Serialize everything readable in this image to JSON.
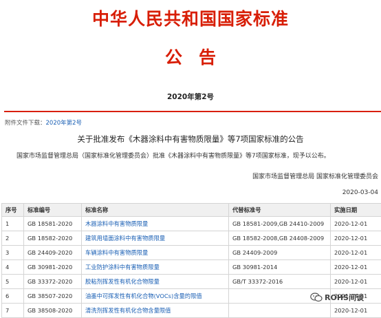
{
  "header": {
    "title": "中华人民共和国国家标准",
    "notice": "公告",
    "issue": "2020年第2号"
  },
  "attachment": {
    "label": "附件文件下载：",
    "link": "2020年第2号"
  },
  "announcement": {
    "title": "关于批准发布《木器涂料中有害物质限量》等7项国家标准的公告",
    "body": "国家市场监督管理总局（国家标准化管理委员会）批准《木器涂料中有害物质限量》等7项国家标准，现予以公布。",
    "signer": "国家市场监督管理总局 国家标准化管理委员会",
    "date": "2020-03-04"
  },
  "table": {
    "headers": [
      "序号",
      "标准编号",
      "标准名称",
      "代替标准号",
      "实施日期"
    ],
    "rows": [
      [
        "1",
        "GB 18581-2020",
        "木器涂料中有害物质限量",
        "GB 18581-2009,GB 24410-2009",
        "2020-12-01"
      ],
      [
        "2",
        "GB 18582-2020",
        "建筑用墙面涂料中有害物质限量",
        "GB 18582-2008,GB 24408-2009",
        "2020-12-01"
      ],
      [
        "3",
        "GB 24409-2020",
        "车辆涂料中有害物质限量",
        "GB 24409-2009",
        "2020-12-01"
      ],
      [
        "4",
        "GB 30981-2020",
        "工业防护涂料中有害物质限量",
        "GB 30981-2014",
        "2020-12-01"
      ],
      [
        "5",
        "GB 33372-2020",
        "胶粘剂挥发性有机化合物限量",
        "GB/T 33372-2016",
        "2020-12-01"
      ],
      [
        "6",
        "GB 38507-2020",
        "油墨中可挥发性有机化合物(VOCs)含量的限值",
        "",
        "2021-04-01"
      ],
      [
        "7",
        "GB 38508-2020",
        "清洗剂挥发性有机化合物含量限值",
        "",
        "2020-12-01"
      ]
    ]
  },
  "watermark": {
    "text": "ROHS间谈",
    "icon": "wechat-icon"
  },
  "colors": {
    "title_red": "#d81e06",
    "link_blue": "#1a5fb4"
  }
}
